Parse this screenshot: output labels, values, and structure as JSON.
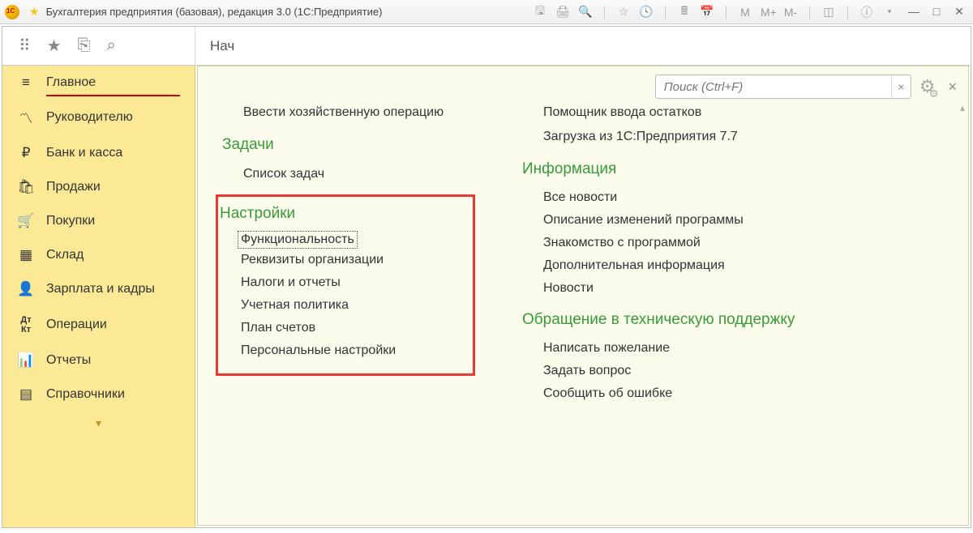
{
  "title": "Бухгалтерия предприятия (базовая), редакция 3.0  (1С:Предприятие)",
  "tab_hint": "Нач",
  "search": {
    "placeholder": "Поиск (Ctrl+F)"
  },
  "sidebar": [
    {
      "icon": "menu",
      "label": "Главное",
      "active": true
    },
    {
      "icon": "trend",
      "label": "Руководителю"
    },
    {
      "icon": "ruble",
      "label": "Банк и касса"
    },
    {
      "icon": "bag",
      "label": "Продажи"
    },
    {
      "icon": "cart",
      "label": "Покупки"
    },
    {
      "icon": "grid",
      "label": "Склад"
    },
    {
      "icon": "person",
      "label": "Зарплата и кадры"
    },
    {
      "icon": "dtkt",
      "label": "Операции"
    },
    {
      "icon": "bars",
      "label": "Отчеты"
    },
    {
      "icon": "books",
      "label": "Справочники"
    }
  ],
  "left_column": {
    "top_link": "Ввести хозяйственную операцию",
    "tasks": {
      "title": "Задачи",
      "items": [
        "Список задач"
      ]
    },
    "settings": {
      "title": "Настройки",
      "items": [
        "Функциональность",
        "Реквизиты организации",
        "Налоги и отчеты",
        "Учетная политика",
        "План счетов",
        "Персональные настройки"
      ]
    }
  },
  "right_column": {
    "start": {
      "items": [
        "Помощник ввода остатков",
        "Загрузка из 1С:Предприятия 7.7"
      ]
    },
    "info": {
      "title": "Информация",
      "items": [
        "Все новости",
        "Описание изменений программы",
        "Знакомство с программой",
        "Дополнительная информация",
        "Новости"
      ]
    },
    "support": {
      "title": "Обращение в техническую поддержку",
      "items": [
        "Написать пожелание",
        "Задать вопрос",
        "Сообщить об ошибке"
      ]
    }
  },
  "tb": {
    "m": "M",
    "mp": "M+",
    "mm": "M-"
  }
}
